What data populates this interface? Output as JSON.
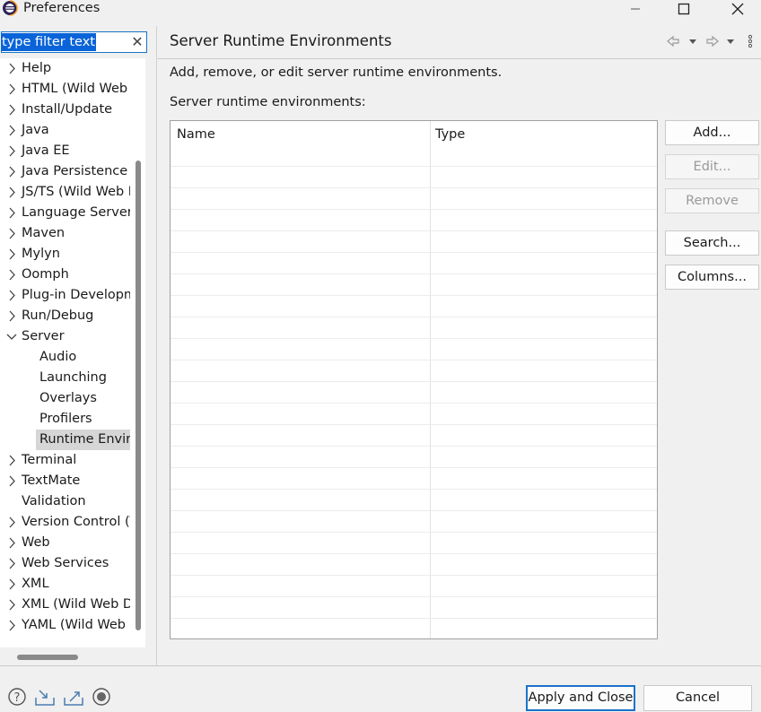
{
  "window": {
    "title": "Preferences",
    "controls": [
      "minimize-icon",
      "maximize-icon",
      "close-icon"
    ]
  },
  "filter": {
    "value": "type filter text",
    "clear_icon": "clear-icon"
  },
  "tree": {
    "items": [
      {
        "label": "Help",
        "expandable": true,
        "level": 0
      },
      {
        "label": "HTML (Wild Web Developer)",
        "expandable": true,
        "level": 0
      },
      {
        "label": "Install/Update",
        "expandable": true,
        "level": 0
      },
      {
        "label": "Java",
        "expandable": true,
        "level": 0
      },
      {
        "label": "Java EE",
        "expandable": true,
        "level": 0
      },
      {
        "label": "Java Persistence",
        "expandable": true,
        "level": 0
      },
      {
        "label": "JS/TS (Wild Web Developer)",
        "expandable": true,
        "level": 0
      },
      {
        "label": "Language Servers",
        "expandable": true,
        "level": 0
      },
      {
        "label": "Maven",
        "expandable": true,
        "level": 0
      },
      {
        "label": "Mylyn",
        "expandable": true,
        "level": 0
      },
      {
        "label": "Oomph",
        "expandable": true,
        "level": 0
      },
      {
        "label": "Plug-in Development",
        "expandable": true,
        "level": 0
      },
      {
        "label": "Run/Debug",
        "expandable": true,
        "level": 0
      },
      {
        "label": "Server",
        "expandable": true,
        "expanded": true,
        "level": 0
      },
      {
        "label": "Audio",
        "expandable": false,
        "level": 1
      },
      {
        "label": "Launching",
        "expandable": false,
        "level": 1
      },
      {
        "label": "Overlays",
        "expandable": false,
        "level": 1
      },
      {
        "label": "Profilers",
        "expandable": false,
        "level": 1
      },
      {
        "label": "Runtime Environments",
        "expandable": false,
        "level": 1,
        "selected": true
      },
      {
        "label": "Terminal",
        "expandable": true,
        "level": 0
      },
      {
        "label": "TextMate",
        "expandable": true,
        "level": 0
      },
      {
        "label": "Validation",
        "expandable": false,
        "level": 0
      },
      {
        "label": "Version Control (Team)",
        "expandable": true,
        "level": 0
      },
      {
        "label": "Web",
        "expandable": true,
        "level": 0
      },
      {
        "label": "Web Services",
        "expandable": true,
        "level": 0
      },
      {
        "label": "XML",
        "expandable": true,
        "level": 0
      },
      {
        "label": "XML (Wild Web Developer)",
        "expandable": true,
        "level": 0
      },
      {
        "label": "YAML (Wild Web Developer)",
        "expandable": true,
        "level": 0
      }
    ]
  },
  "page": {
    "title": "Server Runtime Environments",
    "description": "Add, remove, or edit server runtime environments.",
    "table_label": "Server runtime environments:",
    "nav_icons": [
      "back-icon",
      "back-menu-icon",
      "forward-icon",
      "forward-menu-icon",
      "view-menu-icon"
    ]
  },
  "table": {
    "columns": [
      "Name",
      "Type"
    ],
    "rows": []
  },
  "buttons": {
    "add": "Add...",
    "edit": "Edit...",
    "remove": "Remove",
    "search": "Search...",
    "columns": "Columns..."
  },
  "footer": {
    "icons": [
      "help-icon",
      "import-icon",
      "export-icon",
      "record-icon"
    ],
    "apply_close": "Apply and Close",
    "cancel": "Cancel"
  },
  "colors": {
    "accent": "#1a73c8",
    "selection": "#0a64d8",
    "background": "#f0f0f0"
  }
}
